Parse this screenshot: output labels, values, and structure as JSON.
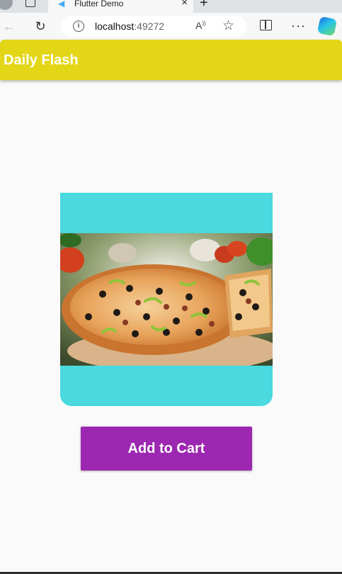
{
  "browser": {
    "tab_title": "Flutter Demo",
    "tab_close_glyph": "×",
    "new_tab_glyph": "+",
    "url_host": "localhost",
    "url_port": ":49272",
    "more_glyph": "···",
    "icons": [
      "profile-icon",
      "tab-actions-icon",
      "flutter-favicon",
      "close-icon",
      "new-tab-icon",
      "back-icon",
      "reload-icon",
      "site-info-icon",
      "read-aloud-icon",
      "favorite-star-icon",
      "split-screen-icon",
      "more-icon",
      "copilot-icon"
    ]
  },
  "app": {
    "title": "Daily Flash",
    "appbar_color": "#e3d616",
    "card_color": "#49d9df",
    "button_color": "#9c27b0",
    "add_to_cart_label": "Add to Cart"
  }
}
